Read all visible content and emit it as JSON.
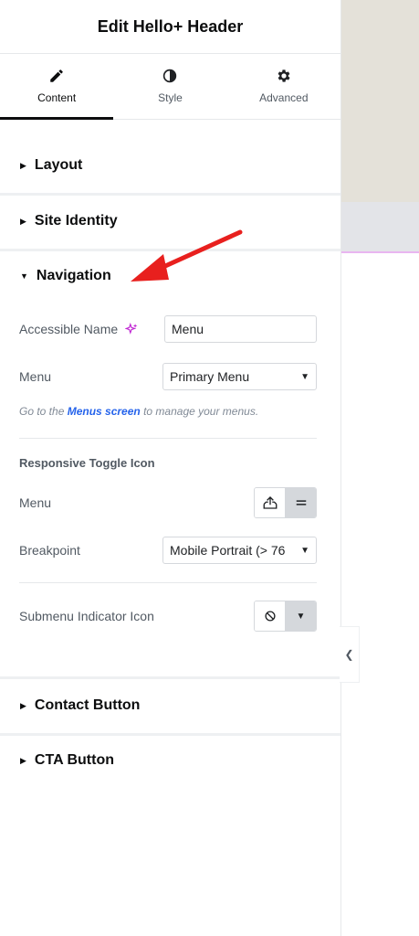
{
  "header": {
    "title": "Edit Hello+ Header"
  },
  "tabs": [
    {
      "label": "Content",
      "icon": "pencil-icon",
      "active": true
    },
    {
      "label": "Style",
      "icon": "half-circle-icon",
      "active": false
    },
    {
      "label": "Advanced",
      "icon": "gear-icon",
      "active": false
    }
  ],
  "sections": {
    "layout": "Layout",
    "site_identity": "Site Identity",
    "navigation": "Navigation",
    "contact_button": "Contact Button",
    "cta_button": "CTA Button"
  },
  "navigation": {
    "accessible_name_label": "Accessible Name",
    "accessible_name_value": "Menu",
    "menu_label": "Menu",
    "menu_value": "Primary Menu",
    "hint_prefix": "Go to the ",
    "hint_link": "Menus screen",
    "hint_suffix": " to manage your menus.",
    "toggle_heading": "Responsive Toggle Icon",
    "toggle_menu_label": "Menu",
    "breakpoint_label": "Breakpoint",
    "breakpoint_value": "Mobile Portrait (> 76",
    "submenu_label": "Submenu Indicator Icon"
  },
  "colors": {
    "accent_ai": "#c026d3",
    "link": "#2563eb",
    "annotation_arrow": "#e8201e"
  }
}
